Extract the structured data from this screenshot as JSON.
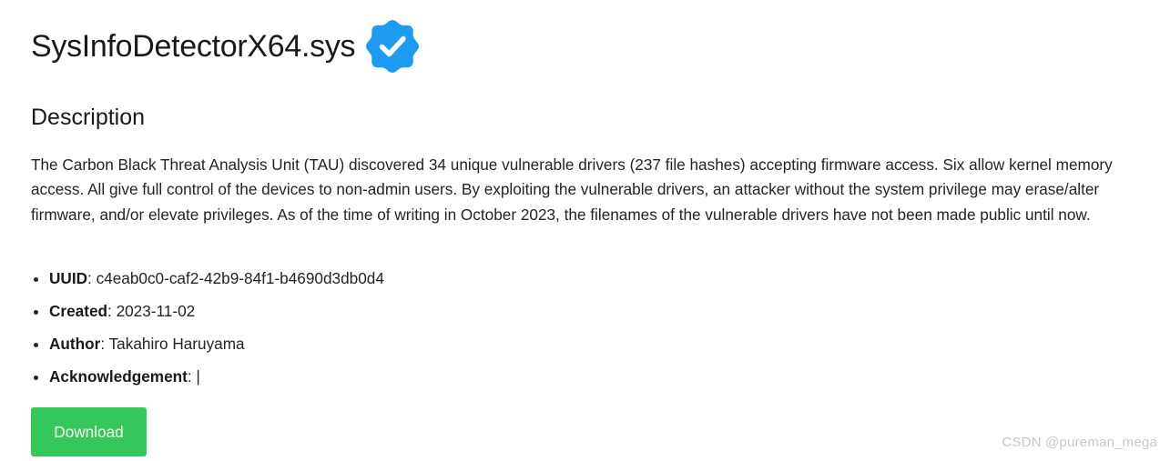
{
  "header": {
    "title": "SysInfoDetectorX64.sys",
    "verified_icon": "verified-badge-icon",
    "verified_color": "#1d9bf0"
  },
  "description": {
    "heading": "Description",
    "text": "The Carbon Black Threat Analysis Unit (TAU) discovered 34 unique vulnerable drivers (237 file hashes) accepting firmware access. Six allow kernel memory access. All give full control of the devices to non-admin users. By exploiting the vulnerable drivers, an attacker without the system privilege may erase/alter firmware, and/or elevate privileges. As of the time of writing in October 2023, the filenames of the vulnerable drivers have not been made public until now."
  },
  "meta": {
    "uuid_label": "UUID",
    "uuid_value": "c4eab0c0-caf2-42b9-84f1-b4690d3db0d4",
    "created_label": "Created",
    "created_value": "2023-11-02",
    "author_label": "Author",
    "author_value": "Takahiro Haruyama",
    "ack_label": "Acknowledgement",
    "ack_value": "|"
  },
  "actions": {
    "download_label": "Download",
    "download_color": "#34c759"
  },
  "watermark": {
    "text": "CSDN @pureman_mega"
  }
}
